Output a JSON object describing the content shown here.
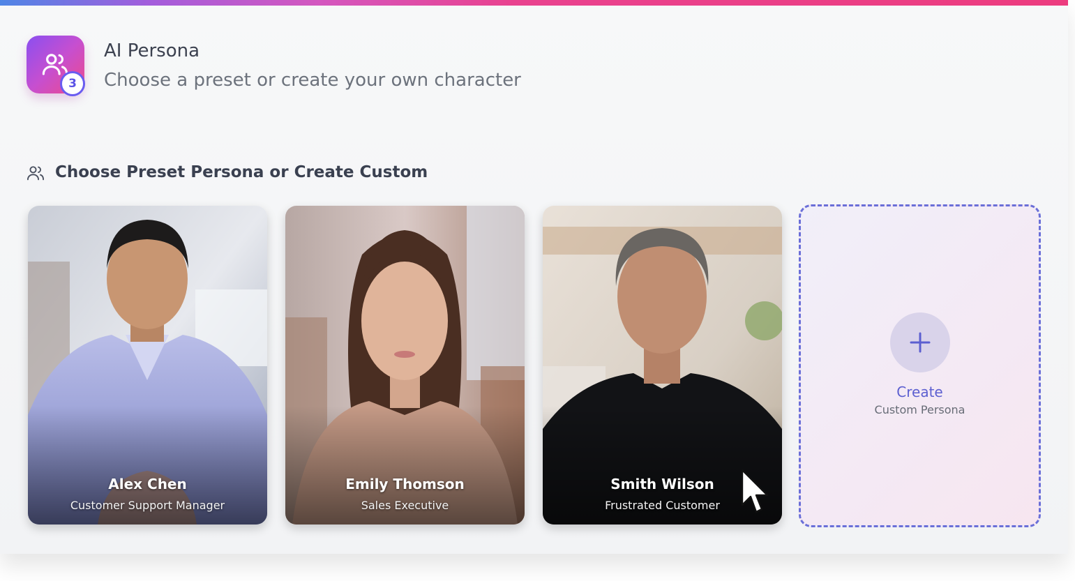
{
  "header": {
    "title": "AI Persona",
    "subtitle": "Choose a preset or create your own character",
    "step_number": "3",
    "icon": "users-icon"
  },
  "section": {
    "title": "Choose Preset Persona or Create Custom",
    "icon": "users-icon"
  },
  "personas": [
    {
      "name": "Alex Chen",
      "role": "Customer Support Manager"
    },
    {
      "name": "Emily Thomson",
      "role": "Sales Executive"
    },
    {
      "name": "Smith Wilson",
      "role": "Frustrated Customer"
    }
  ],
  "create_card": {
    "label": "Create",
    "sublabel": "Custom Persona",
    "icon": "plus-icon"
  },
  "colors": {
    "accent": "#5c5fd0",
    "gradient_start": "#8a4ff0",
    "gradient_end": "#ee4a8a"
  }
}
